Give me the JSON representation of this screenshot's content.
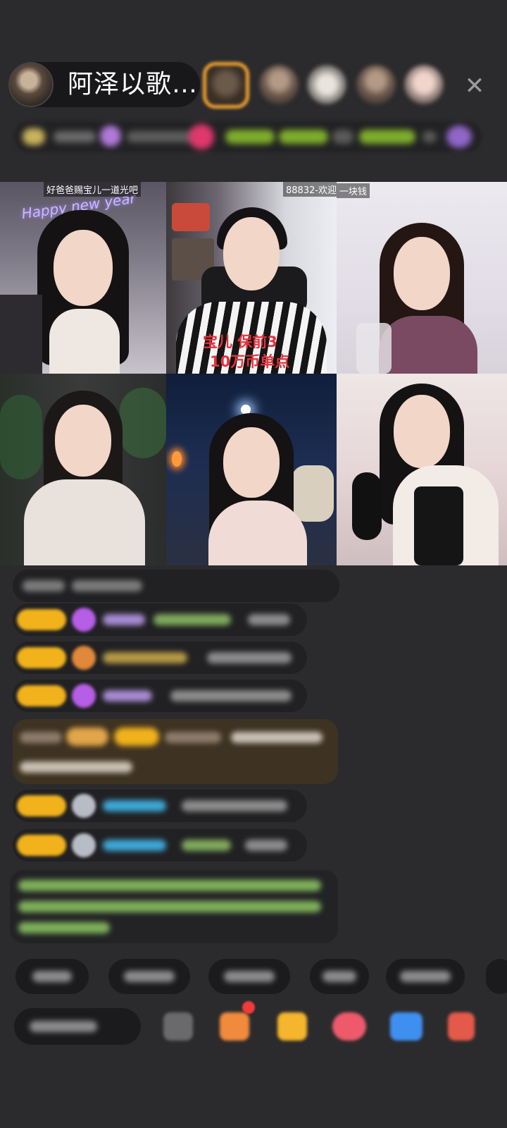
{
  "header": {
    "host_name": "阿泽以歌…",
    "close_label": "✕"
  },
  "video_tiles": [
    {
      "label": "好爸爸赐宝儿一道光吧",
      "neon_text": "Happy new year"
    },
    {
      "label": "88832-欢迎",
      "overlay_line1": "宝儿 保前3",
      "overlay_line2": "10万币单点"
    },
    {
      "label": "一块钱"
    },
    {
      "label": ""
    },
    {
      "label": ""
    },
    {
      "label": ""
    }
  ],
  "colors": {
    "background": "#2b2b2d",
    "badge_gold": "#f1b21c",
    "accent_orange": "#f3a330",
    "overlay_red": "#e8323c",
    "chat_green": "#8bcf5a",
    "chat_blue": "#3ea7d6"
  }
}
